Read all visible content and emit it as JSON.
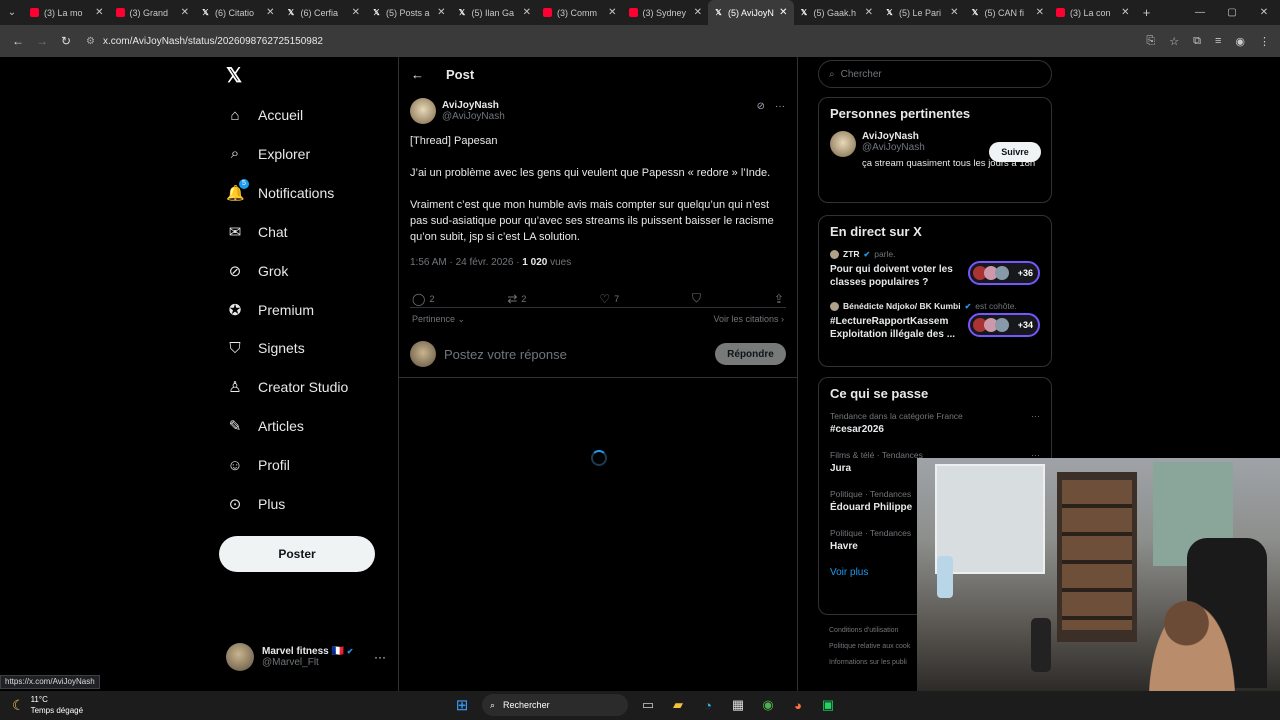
{
  "browser": {
    "tabs": [
      {
        "label": "(3) La mo",
        "kind": "yt"
      },
      {
        "label": "(3) Grand",
        "kind": "yt"
      },
      {
        "label": "(6) Citatio",
        "kind": "x"
      },
      {
        "label": "(6) Cerfia",
        "kind": "x"
      },
      {
        "label": "(5) Posts a",
        "kind": "x"
      },
      {
        "label": "(5) Ilan Ga",
        "kind": "x"
      },
      {
        "label": "(3) Comm",
        "kind": "yt"
      },
      {
        "label": "(3) Sydney",
        "kind": "yt"
      },
      {
        "label": "(5) AviJoyN",
        "kind": "x",
        "active": true
      },
      {
        "label": "(5) Gaak.h",
        "kind": "x"
      },
      {
        "label": "(5) Le Pari",
        "kind": "x"
      },
      {
        "label": "(5) CAN fi",
        "kind": "x"
      },
      {
        "label": "(3) La con",
        "kind": "yt"
      }
    ],
    "url": "x.com/AviJoyNash/status/2026098762725150982",
    "status_url": "https://x.com/AviJoyNash"
  },
  "nav": {
    "items": [
      {
        "label": "Accueil",
        "icon": "home-icon",
        "glyph": "⌂"
      },
      {
        "label": "Explorer",
        "icon": "search-icon",
        "glyph": "⌕"
      },
      {
        "label": "Notifications",
        "icon": "bell-icon",
        "glyph": "🔔",
        "badge": "5"
      },
      {
        "label": "Chat",
        "icon": "mail-icon",
        "glyph": "✉"
      },
      {
        "label": "Grok",
        "icon": "grok-icon",
        "glyph": "⊘"
      },
      {
        "label": "Premium",
        "icon": "premium-icon",
        "glyph": "✪"
      },
      {
        "label": "Signets",
        "icon": "bookmark-icon",
        "glyph": "⛉"
      },
      {
        "label": "Creator Studio",
        "icon": "creator-icon",
        "glyph": "♙"
      },
      {
        "label": "Articles",
        "icon": "article-icon",
        "glyph": "✎"
      },
      {
        "label": "Profil",
        "icon": "profile-icon",
        "glyph": "☺"
      },
      {
        "label": "Plus",
        "icon": "more-icon",
        "glyph": "⊙"
      }
    ],
    "post_label": "Poster",
    "account": {
      "name": "Marvel fitness",
      "flag": "🇫🇷",
      "handle": "@Marvel_Flt"
    }
  },
  "post": {
    "header_title": "Post",
    "author_name": "AviJoyNash",
    "author_handle": "@AviJoyNash",
    "paragraphs": [
      "[Thread] Papesan",
      "J’ai un problème avec les gens qui veulent que Papessn « redore » l’Inde.",
      "Vraiment c’est que mon humble avis mais compter sur quelqu’un qui n’est pas sud-asiatique pour qu’avec ses streams ils puissent baisser le racisme qu’on subit, jsp si c’est LA solution."
    ],
    "time": "1:56 AM · 24 févr. 2026 · ",
    "views_count": "1 020",
    "views_label": " vues",
    "stats": {
      "replies": "2",
      "reposts": "2",
      "likes": "7"
    },
    "sort_label": "Pertinence",
    "quotes_label": "Voir les citations",
    "reply_placeholder": "Postez votre réponse",
    "reply_button": "Répondre"
  },
  "sidebar": {
    "search_placeholder": "Chercher",
    "relevant": {
      "title": "Personnes pertinentes",
      "name": "AviJoyNash",
      "handle": "@AviJoyNash",
      "bio": "ça stream quasiment tous les jours à 18h",
      "follow": "Suivre"
    },
    "live": {
      "title": "En direct sur X",
      "items": [
        {
          "host": "ZTR",
          "status": "parle.",
          "title": "Pour qui doivent voter les classes populaires ?",
          "count": "+36"
        },
        {
          "host": "Bénédicte Ndjoko/ BK Kumbi",
          "status": "est cohôte.",
          "title": "#LectureRapportKassem Exploitation illégale des ...",
          "count": "+34"
        }
      ]
    },
    "trends": {
      "title": "Ce qui se passe",
      "items": [
        {
          "category": "Tendance dans la catégorie France",
          "name": "#cesar2026"
        },
        {
          "category": "Films & télé · Tendances",
          "name": "Jura"
        },
        {
          "category": "Politique · Tendances",
          "name": "Édouard Philippe"
        },
        {
          "category": "Politique · Tendances",
          "name": "Havre"
        }
      ],
      "see_more": "Voir plus"
    },
    "footer": [
      "Conditions d'utilisation",
      "Politique relative aux cook",
      "Informations sur les publi"
    ]
  },
  "taskbar": {
    "temp": "11°C",
    "weather": "Temps dégagé",
    "search": "Rechercher"
  }
}
